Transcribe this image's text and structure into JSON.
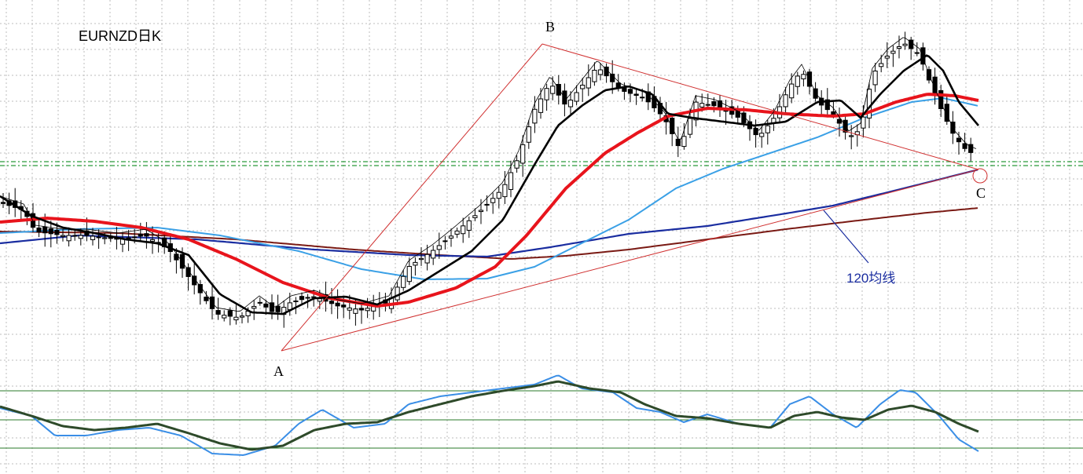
{
  "chart_data": {
    "type": "candlestick",
    "title": "EURNZD日K",
    "colors": {
      "background": "#ffffff",
      "grid": "#bdbdbd",
      "candle": "#000000",
      "ma_fast": "#000000",
      "ma_medium": "#000000",
      "ma_red": "#e8141c",
      "ma_light_blue": "#3aa0e6",
      "ma_120": "#1a2da0",
      "ma_brown": "#7a1a14",
      "trendline": "#d03030",
      "support_level": "#2a9a3a",
      "annotation_text": "#1a2da0",
      "osc_fast": "#3a8ee6",
      "osc_signal": "#2e4a2a",
      "osc_bands": "#2a7a2a"
    },
    "annotations": {
      "point_a": "A",
      "point_b": "B",
      "point_c": "C",
      "ma_label": "120均线"
    },
    "oscillator": {
      "levels": [
        "upper",
        "middle",
        "lower"
      ]
    }
  }
}
